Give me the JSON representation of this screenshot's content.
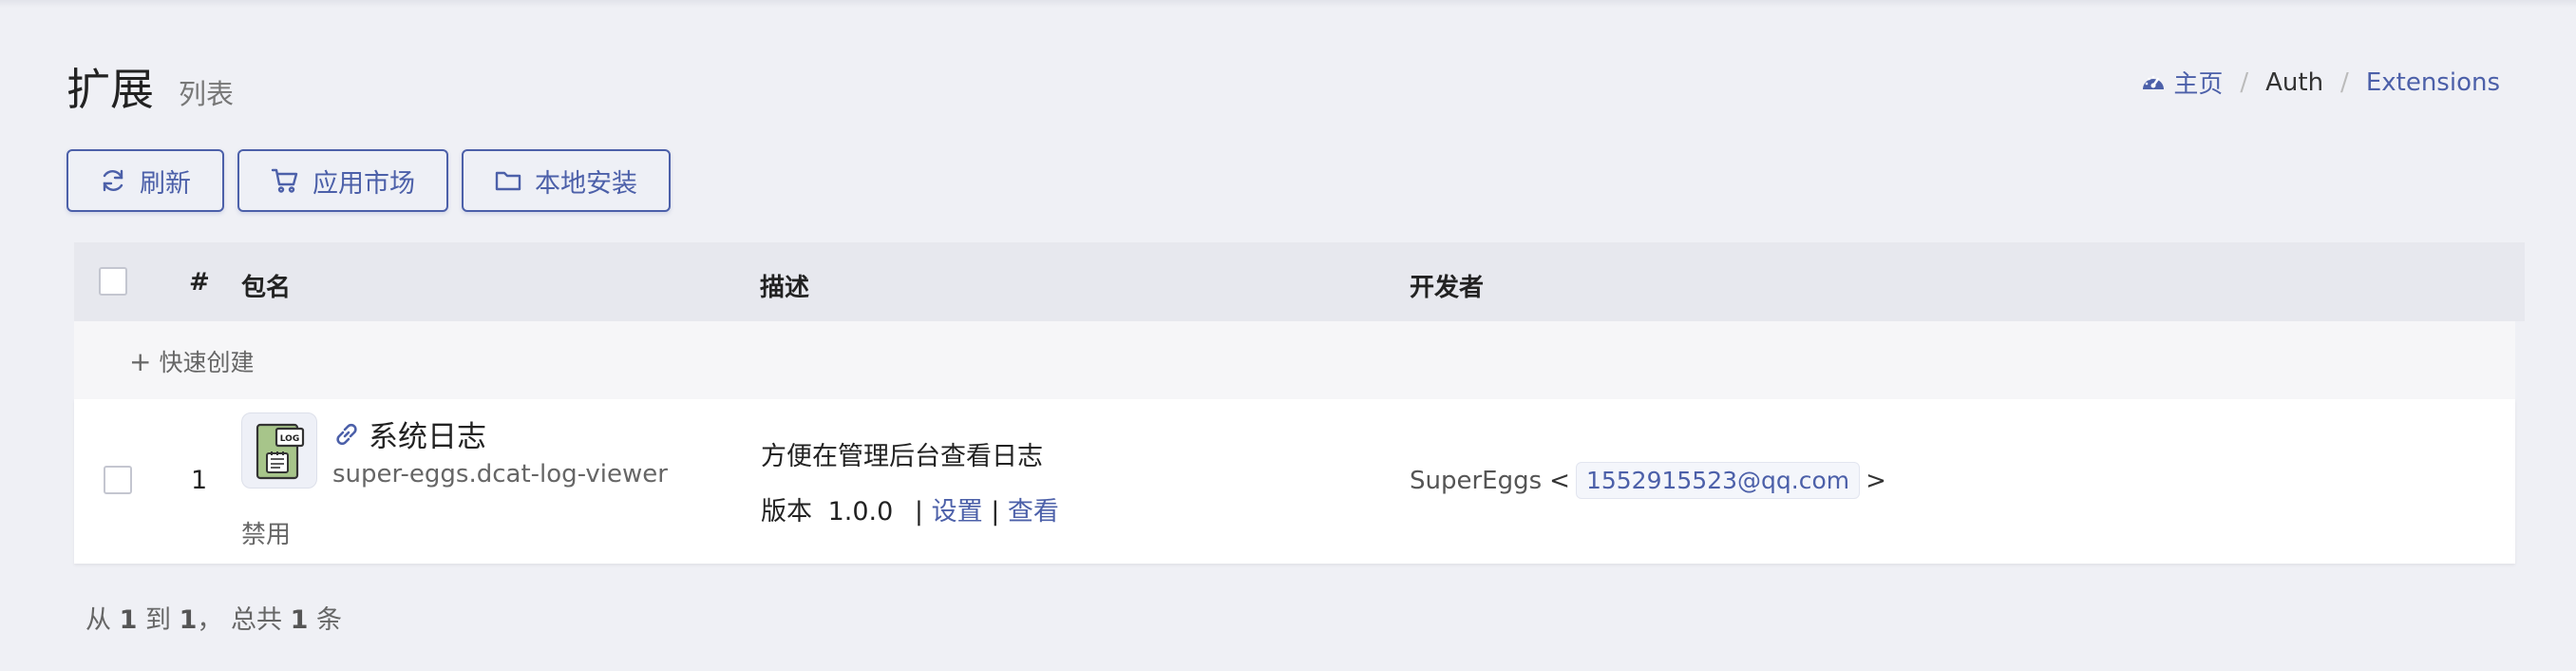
{
  "header": {
    "title": "扩展",
    "subtitle": "列表"
  },
  "breadcrumb": {
    "home": "主页",
    "separator": "/",
    "auth": "Auth",
    "extensions": "Extensions"
  },
  "toolbar": {
    "refresh_label": "刷新",
    "market_label": "应用市场",
    "local_install_label": "本地安装"
  },
  "table": {
    "columns": {
      "index": "#",
      "package": "包名",
      "description": "描述",
      "developer": "开发者"
    },
    "quick_create": {
      "plus": "+",
      "label": "快速创建"
    },
    "rows": [
      {
        "index": "1",
        "icon": "log-file-icon",
        "name": "系统日志",
        "package_id": "super-eggs.dcat-log-viewer",
        "status_action": "禁用",
        "description": "方便在管理后台查看日志",
        "version_label": "版本",
        "version": "1.0.0",
        "pipe": "|",
        "settings_label": "设置",
        "view_label": "查看",
        "developer_name": "SuperEggs",
        "lt": "<",
        "developer_email": "1552915523@qq.com",
        "gt": ">"
      }
    ]
  },
  "pagination": {
    "from_label": "从",
    "from": "1",
    "to_label": "到",
    "to": "1",
    "comma": "，",
    "total_label": "总共",
    "total": "1",
    "unit": "条"
  },
  "colors": {
    "accent": "#4c60a9",
    "background": "#eff0f5",
    "header_row": "#e7e8ee"
  }
}
